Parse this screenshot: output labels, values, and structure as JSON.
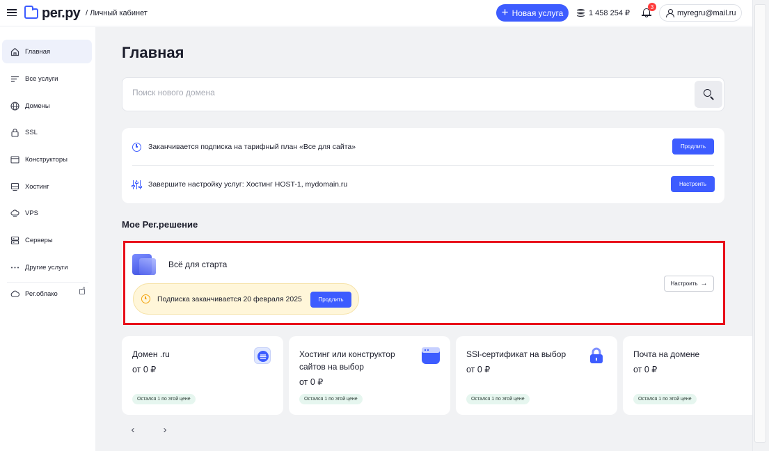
{
  "header": {
    "logo_text": "рег.ру",
    "breadcrumb": "/ Личный кабинет",
    "new_service_label": "Новая услуга",
    "balance": "1 458 254 ₽",
    "notifications_count": "3",
    "user_email": "myregru@mail.ru"
  },
  "sidebar": {
    "items": [
      {
        "label": "Главная",
        "icon": "home-icon",
        "active": true
      },
      {
        "label": "Все услуги",
        "icon": "list-icon"
      },
      {
        "label": "Домены",
        "icon": "globe-icon"
      },
      {
        "label": "SSL",
        "icon": "lock-icon"
      },
      {
        "label": "Конструкторы",
        "icon": "browser-window-icon"
      },
      {
        "label": "Хостинг",
        "icon": "hosting-icon"
      },
      {
        "label": "VPS",
        "icon": "cloud-server-icon"
      },
      {
        "label": "Серверы",
        "icon": "server-icon"
      },
      {
        "label": "Другие услуги",
        "icon": "more-icon"
      },
      {
        "label": "Рег.облако",
        "icon": "cloud-icon",
        "external": true
      }
    ]
  },
  "main": {
    "title": "Главная",
    "search": {
      "placeholder": "Поиск нового домена"
    },
    "notices": [
      {
        "text": "Заканчивается подписка на тарифный план «Все для сайта»",
        "button": "Продлить",
        "icon": "clock-icon"
      },
      {
        "text": "Завершите настройку услуг: Хостинг HOST-1, mydomain.ru",
        "button": "Настроить",
        "icon": "sliders-icon"
      }
    ],
    "solution_section_title": "Мое Рег.решение",
    "solution": {
      "name": "Всё для старта",
      "expiry_text": "Подписка заканчивается 20 февраля 2025",
      "renew_button": "Продлить",
      "configure_button": "Настроить"
    },
    "offers": [
      {
        "title": "Домен .ru",
        "price": "от 0 ₽",
        "badge": "Остался 1 по этой цене"
      },
      {
        "title": "Хостинг или конструктор сайтов на выбор",
        "price": "от 0 ₽",
        "badge": "Остался 1 по этой цене"
      },
      {
        "title": "SSl-сертификат на выбор",
        "price": "от 0 ₽",
        "badge": "Остался 1 по этой цене"
      },
      {
        "title": "Почта на домене",
        "price": "от 0 ₽",
        "badge": "Остался 1 по этой цене"
      }
    ]
  },
  "colors": {
    "accent": "#3d5cff",
    "highlight": "#e8101a",
    "warning_bg": "#fff6d9",
    "badge_bg": "#e6f6ef"
  }
}
